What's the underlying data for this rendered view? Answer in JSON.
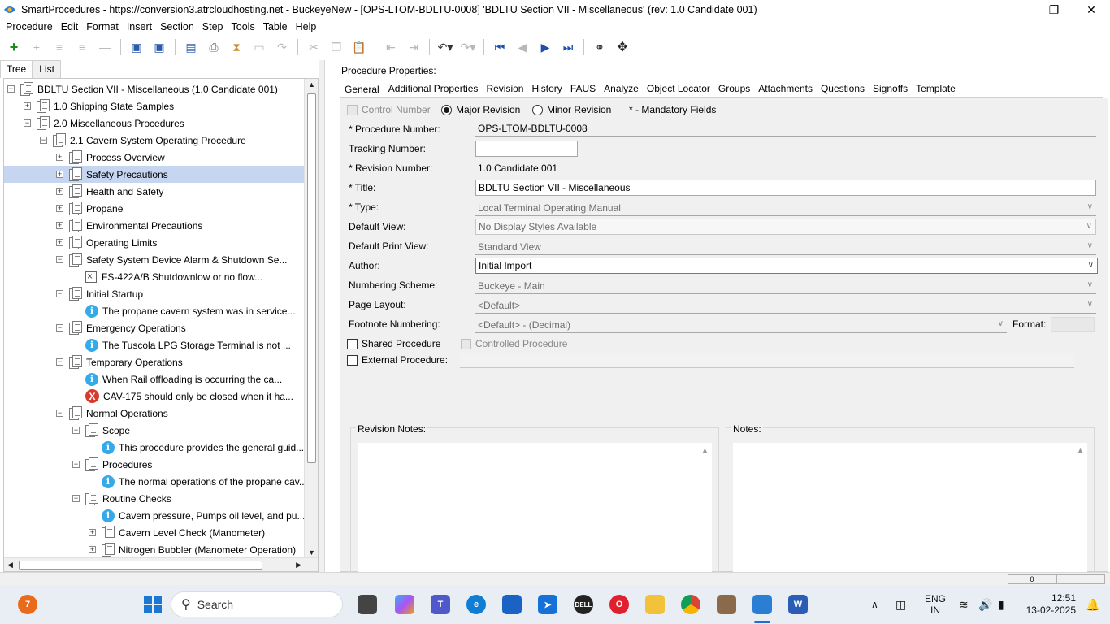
{
  "window": {
    "title": "SmartProcedures - https://conversion3.atrcloudhosting.net - BuckeyeNew - [OPS-LTOM-BDLTU-0008] 'BDLTU Section VII - Miscellaneous' (rev: 1.0 Candidate 001)"
  },
  "menu": [
    "Procedure",
    "Edit",
    "Format",
    "Insert",
    "Section",
    "Step",
    "Tools",
    "Table",
    "Help"
  ],
  "left_tabs": [
    "Tree",
    "List"
  ],
  "tree": [
    {
      "label": "BDLTU Section VII - Miscellaneous (1.0 Candidate 001)",
      "indent": 0,
      "exp": "−",
      "icon": "doc"
    },
    {
      "label": "1.0 Shipping State Samples",
      "indent": 1,
      "exp": "+",
      "icon": "doc"
    },
    {
      "label": "2.0 Miscellaneous Procedures",
      "indent": 1,
      "exp": "−",
      "icon": "doc"
    },
    {
      "label": "2.1 Cavern System Operating Procedure",
      "indent": 2,
      "exp": "−",
      "icon": "doc"
    },
    {
      "label": "Process Overview",
      "indent": 3,
      "exp": "+",
      "icon": "doc"
    },
    {
      "label": "Safety Precautions",
      "indent": 3,
      "exp": "+",
      "icon": "doc",
      "selected": true
    },
    {
      "label": "Health and Safety",
      "indent": 3,
      "exp": "+",
      "icon": "doc"
    },
    {
      "label": "Propane",
      "indent": 3,
      "exp": "+",
      "icon": "doc"
    },
    {
      "label": "Environmental Precautions",
      "indent": 3,
      "exp": "+",
      "icon": "doc"
    },
    {
      "label": "Operating Limits",
      "indent": 3,
      "exp": "+",
      "icon": "doc"
    },
    {
      "label": "Safety System Device Alarm & Shutdown Se...",
      "indent": 3,
      "exp": "−",
      "icon": "doc"
    },
    {
      "label": "FS-422A/B Shutdownlow or no flow...",
      "indent": 4,
      "exp": "",
      "icon": "image"
    },
    {
      "label": "Initial Startup",
      "indent": 3,
      "exp": "−",
      "icon": "doc"
    },
    {
      "label": "The propane cavern system was in service...",
      "indent": 4,
      "exp": "",
      "icon": "info"
    },
    {
      "label": "Emergency Operations",
      "indent": 3,
      "exp": "−",
      "icon": "doc"
    },
    {
      "label": "The Tuscola LPG Storage Terminal is not ...",
      "indent": 4,
      "exp": "",
      "icon": "info"
    },
    {
      "label": "Temporary Operations",
      "indent": 3,
      "exp": "−",
      "icon": "doc"
    },
    {
      "label": "When Rail offloading is occurring the ca...",
      "indent": 4,
      "exp": "",
      "icon": "info"
    },
    {
      "label": "CAV-175 should only be closed when it ha...",
      "indent": 4,
      "exp": "",
      "icon": "x"
    },
    {
      "label": "Normal Operations",
      "indent": 3,
      "exp": "−",
      "icon": "doc"
    },
    {
      "label": "Scope",
      "indent": 4,
      "exp": "−",
      "icon": "doc"
    },
    {
      "label": "This procedure provides the general guid...",
      "indent": 5,
      "exp": "",
      "icon": "info"
    },
    {
      "label": "Procedures",
      "indent": 4,
      "exp": "−",
      "icon": "doc"
    },
    {
      "label": "The normal operations of the propane cav...",
      "indent": 5,
      "exp": "",
      "icon": "info"
    },
    {
      "label": "Routine Checks",
      "indent": 4,
      "exp": "−",
      "icon": "doc"
    },
    {
      "label": "Cavern pressure, Pumps oil level, and pu...",
      "indent": 5,
      "exp": "",
      "icon": "info"
    },
    {
      "label": "Cavern Level Check (Manometer)",
      "indent": 5,
      "exp": "+",
      "icon": "doc"
    },
    {
      "label": "Nitrogen Bubbler (Manometer Operation)",
      "indent": 5,
      "exp": "+",
      "icon": "doc"
    }
  ],
  "props_title": "Procedure Properties:",
  "tabs": [
    "General",
    "Additional Properties",
    "Revision",
    "History",
    "FAUS",
    "Analyze",
    "Object Locator",
    "Groups",
    "Attachments",
    "Questions",
    "Signoffs",
    "Template"
  ],
  "form": {
    "control_number": "Control Number",
    "major_revision": "Major Revision",
    "minor_revision": "Minor Revision",
    "mandatory": "* - Mandatory Fields",
    "procedure_number_label": "* Procedure Number:",
    "procedure_number": "OPS-LTOM-BDLTU-0008",
    "tracking_label": "Tracking Number:",
    "tracking": "",
    "revision_label": "* Revision Number:",
    "revision": "1.0 Candidate 001",
    "title_label": "* Title:",
    "title": "BDLTU Section VII - Miscellaneous",
    "type_label": "* Type:",
    "type": "Local Terminal Operating Manual",
    "default_view_label": "Default View:",
    "default_view": "No Display Styles Available",
    "default_print_label": "Default Print View:",
    "default_print": "Standard View",
    "author_label": "Author:",
    "author": "Initial Import",
    "numbering_label": "Numbering Scheme:",
    "numbering": "Buckeye - Main",
    "page_layout_label": "Page Layout:",
    "page_layout": "<Default>",
    "footnote_label": "Footnote Numbering:",
    "footnote": "<Default> - (Decimal)",
    "format_label": "Format:",
    "shared": "Shared Procedure",
    "controlled": "Controlled Procedure",
    "external": "External Procedure:",
    "revision_notes": "Revision Notes:",
    "notes": "Notes:"
  },
  "taskbar": {
    "search": "Search",
    "badge": "7",
    "lang": "ENG",
    "region": "IN",
    "time": "12:51",
    "date": "13-02-2025"
  },
  "statusbar_value": "0"
}
